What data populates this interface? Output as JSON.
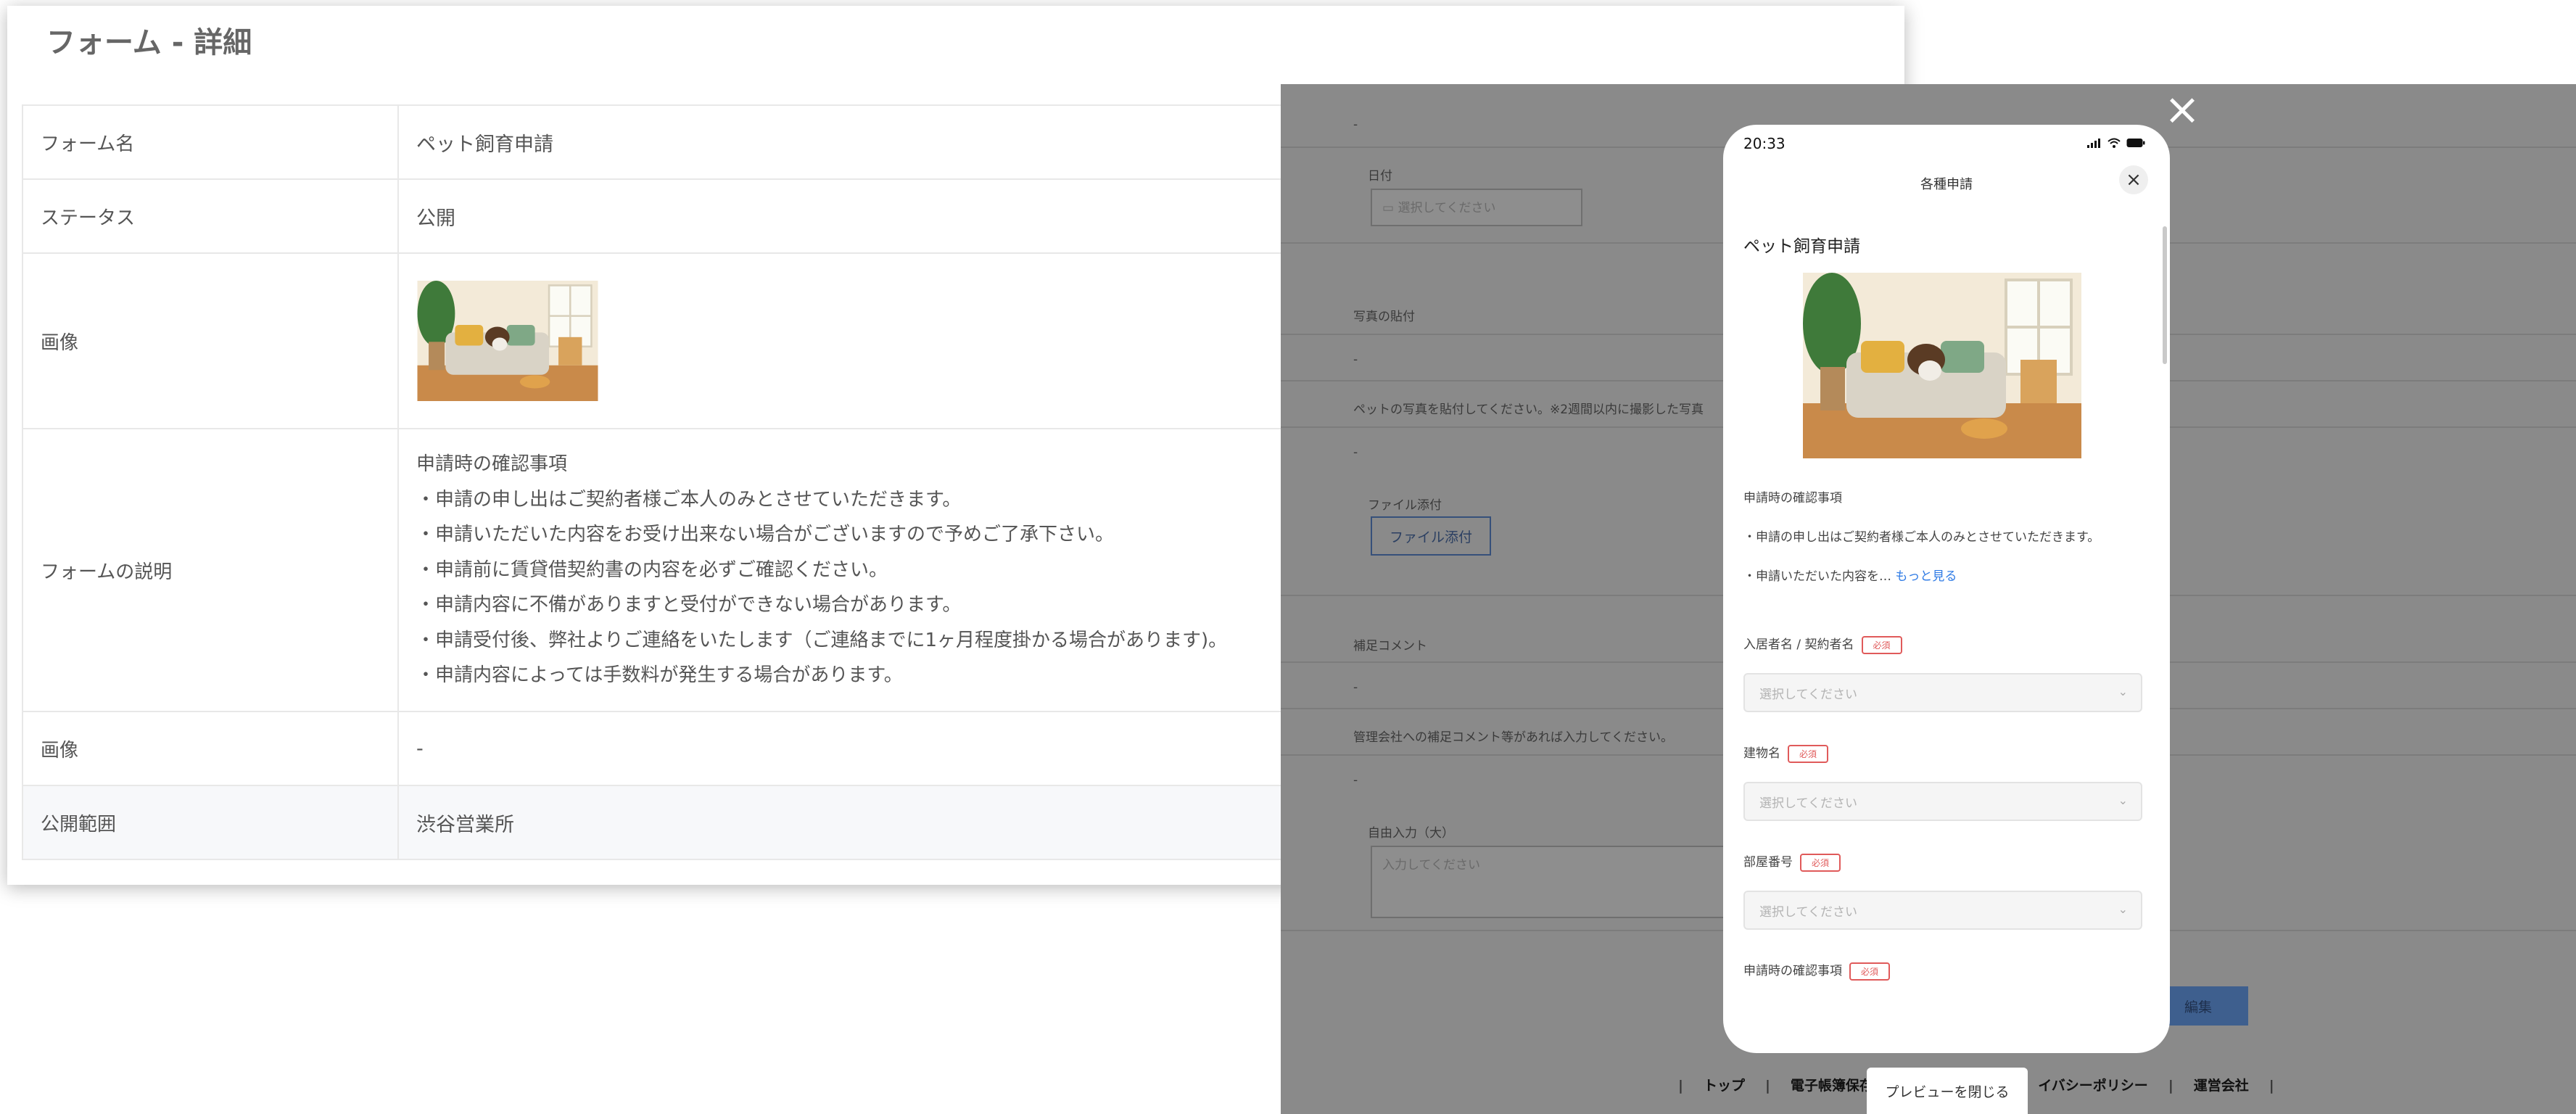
{
  "detail": {
    "title": "フォーム - 詳細",
    "rows": {
      "form_name": {
        "label": "フォーム名",
        "value": "ペット飼育申請"
      },
      "status": {
        "label": "ステータス",
        "value": "公開"
      },
      "image1": {
        "label": "画像"
      },
      "description": {
        "label": "フォームの説明",
        "lines": [
          "申請時の確認事項",
          "・申請の申し出はご契約者様ご本人のみとさせていただきます。",
          "・申請いただいた内容をお受け出来ない場合がございますので予めご了承下さい。",
          "・申請前に賃貸借契約書の内容を必ずご確認ください。",
          "・申請内容に不備がありますと受付ができない場合があります。",
          "・申請受付後、弊社よりご連絡をいたします（ご連絡までに1ヶ月程度掛かる場合があります)。",
          "・申請内容によっては手数料が発生する場合があります。"
        ]
      },
      "image2": {
        "label": "画像",
        "value": "-"
      },
      "scope": {
        "label": "公開範囲",
        "value": "渋谷営業所"
      }
    }
  },
  "background": {
    "dash1": "-",
    "date_label": "日付",
    "date_placeholder": "選択してください",
    "photo_label": "写真の貼付",
    "dash2": "-",
    "photo_desc": "ペットの写真を貼付してください。※2週間以内に撮影した写真",
    "dash3": "-",
    "file_label": "ファイル添付",
    "file_button": "ファイル添付",
    "comment_label": "補足コメント",
    "dash4": "-",
    "comment_desc": "管理会社への補足コメント等があれば入力してください。",
    "dash5": "-",
    "free_label": "自由入力（大）",
    "free_placeholder": "入力してください",
    "edit_button": "編集",
    "footer_links": [
      "トップ",
      "電子帳簿保存法に",
      "イバシーポリシー",
      "運営会社"
    ],
    "close_preview": "プレビューを閉じる"
  },
  "phone": {
    "time": "20:33",
    "header_title": "各種申請",
    "form_title": "ペット飼育申請",
    "desc_heading": "申請時の確認事項",
    "desc_line1": "・申請の申し出はご契約者様ご本人のみとさせていただきます。",
    "desc_line2": "・申請いただいた内容を…",
    "more": "もっと見る",
    "required": "必須",
    "fields": {
      "tenant": {
        "label": "入居者名 / 契約者名",
        "placeholder": "選択してください"
      },
      "building": {
        "label": "建物名",
        "placeholder": "選択してください"
      },
      "room": {
        "label": "部屋番号",
        "placeholder": "選択してください"
      },
      "confirm": {
        "label": "申請時の確認事項"
      }
    }
  },
  "colors": {
    "accent_blue": "#2f7be5",
    "required_red": "#e05a5a",
    "overlay_gray": "#8a8a8a"
  },
  "icons": [
    "close-icon",
    "signal-icon",
    "wifi-icon",
    "battery-icon",
    "chevron-down-icon",
    "calendar-icon"
  ]
}
